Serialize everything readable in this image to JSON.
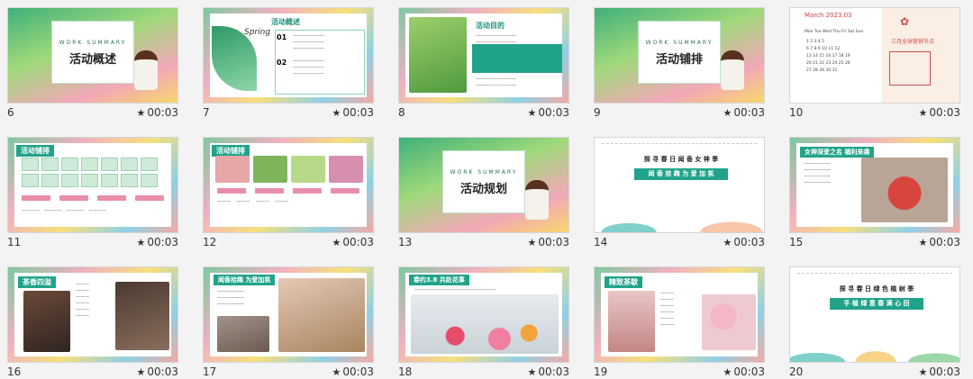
{
  "slides": [
    {
      "num": "6",
      "dur": "00:03",
      "en": "WORK SUMMARY",
      "title": "活动概述"
    },
    {
      "num": "7",
      "dur": "00:03",
      "title": "活动概述",
      "spring": "Spring",
      "items": [
        "01",
        "02"
      ]
    },
    {
      "num": "8",
      "dur": "00:03",
      "title": "活动目的"
    },
    {
      "num": "9",
      "dur": "00:03",
      "en": "WORK SUMMARY",
      "title": "活动铺排"
    },
    {
      "num": "10",
      "dur": "00:03",
      "cal_title": "March  2023.03",
      "weekdays": "Mon Tue Wed Thu Fri Sat Sun",
      "caption": "三月全球营销节点"
    },
    {
      "num": "11",
      "dur": "00:03",
      "title": "活动铺排"
    },
    {
      "num": "12",
      "dur": "00:03",
      "title": "活动铺排"
    },
    {
      "num": "13",
      "dur": "00:03",
      "en": "WORK SUMMARY",
      "title": "活动规划"
    },
    {
      "num": "14",
      "dur": "00:03",
      "banner1": "探 寻 春 日  闻 香 女 神 季",
      "banner2": "闻 香 拾 趣      为 爱 加 氛"
    },
    {
      "num": "15",
      "dur": "00:03",
      "title": "女神深爱之名  福利来袭"
    },
    {
      "num": "16",
      "dur": "00:03",
      "title": "茶香四溢"
    },
    {
      "num": "17",
      "dur": "00:03",
      "title": "闻香拾趣 为爱加氛"
    },
    {
      "num": "18",
      "dur": "00:03",
      "title": "春约3.8 共赴花事"
    },
    {
      "num": "19",
      "dur": "00:03",
      "title": "精致茶歇"
    },
    {
      "num": "20",
      "dur": "00:03",
      "banner1": "探 寻 春 日  绿 色 植 树 季",
      "banner2": "手 植 绿 意      春 满 心 田"
    }
  ],
  "colors": {
    "teal": "#21a38a",
    "pink": "#e88ea8",
    "accent_red": "#c94f4f"
  },
  "icons": {
    "duration": "star-icon"
  }
}
